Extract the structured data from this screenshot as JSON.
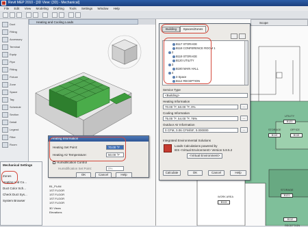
{
  "window": {
    "title": "Revit MEP 2010 - [3D View: {3D} - Mechanical]"
  },
  "menu": [
    "File",
    "Edit",
    "View",
    "Modeling",
    "Drafting",
    "Tools",
    "Settings",
    "Window",
    "Help"
  ],
  "doc_tab": "Heating and Cooling Loads",
  "left_palette": [
    "Duct",
    "Fitting",
    "Accessory",
    "Terminal",
    "Equip",
    "Pipe",
    "Fitting",
    "Fixture",
    "Zone",
    "Space",
    "Tag",
    "Schedule",
    "Section",
    "Detail",
    "Legend",
    "Filter",
    "Room"
  ],
  "browser": {
    "title": "Mechanical Settings",
    "items": [
      "Zones",
      "Heating and Co...",
      "Duct Color Sch...",
      "Check Duct Sys...",
      "System Browser"
    ]
  },
  "plan_toolbar": {
    "label": "Scope"
  },
  "spaces_dialog": {
    "tabs": [
      "Building",
      "Spaces/Zones"
    ],
    "tree": [
      "B117 STORAGE",
      "B118 CONFERENCE ROOM 1",
      "2",
      "B119 STORAGE",
      "B120 UTILITY",
      "3",
      "B180 MAIN HALL",
      "4",
      "3 Space",
      "B112 RECEPTION"
    ],
    "service_type_label": "Service Type",
    "service_type_value": "<Building>",
    "heating_label": "Heating Information",
    "heating_value": "70.00 °F, 50.00 °F, 0%",
    "cooling_label": "Cooling Information",
    "cooling_value": "75.00 °F, 54.00 °F, 76%",
    "outdoor_label": "Outdoor Air Information",
    "outdoor_value": "0 CFM, 0.06 CFM/SF, 0.000000",
    "ies_label": "Integrated Environmental Solutions",
    "ies_text_1": "Loads Calculations powered by",
    "ies_text_2": "IES <Virtual Environment> Version 5.8.5.2",
    "ies_button": "<Virtual Environment>",
    "buttons": [
      "Calculate",
      "OK",
      "Cancel",
      "Help"
    ]
  },
  "heating_dialog": {
    "title": "Heating Information",
    "set_point_label": "Heating Set Point:",
    "set_point_value": "70.00 °F",
    "air_temp_label": "Heating Air Temperature:",
    "air_temp_value": "50.00 °F",
    "humid_label": "Humidification Control",
    "humid_set_label": "Humidification Set Point:",
    "humid_set_value": "0%",
    "buttons": [
      "OK",
      "Cancel",
      "Help"
    ]
  },
  "levels": [
    "B1_PLAN",
    "1ST FLOOR",
    "1ST FLOOR",
    "1ST FLOOR",
    "1ST FLOOR",
    "3D Views",
    "Elevations"
  ],
  "rooms": [
    {
      "label": "UTILITY",
      "code": "B120"
    },
    {
      "label": "STORAGE",
      "code": "B119"
    },
    {
      "label": "MAIN HALL",
      "code": "B180"
    },
    {
      "label": "OFFICE",
      "code": "B115"
    },
    {
      "label": "STORAGE",
      "code": "B121"
    },
    {
      "label": "RECEPTION",
      "code": "B112"
    },
    {
      "label": "WORK AREA",
      "code": "B113"
    }
  ],
  "colors": {
    "accent_red": "#d4483b",
    "zone_green": "#3b9b3b",
    "title_blue": "#2c5595"
  }
}
